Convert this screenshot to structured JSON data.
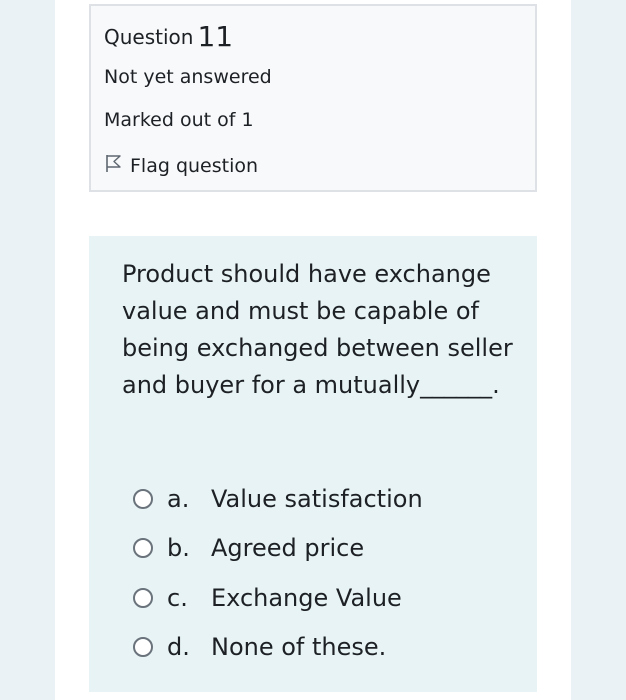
{
  "question_info": {
    "label": "Question",
    "number": "11",
    "state": "Not yet answered",
    "grade": "Marked out of 1",
    "flag_label": "Flag question"
  },
  "question": {
    "text": "Product should have exchange value and must be capable of being exchanged between seller and buyer for a mutually______.",
    "options": [
      {
        "letter": "a.",
        "text": "Value satisfaction"
      },
      {
        "letter": "b.",
        "text": "Agreed price"
      },
      {
        "letter": "c.",
        "text": "Exchange Value"
      },
      {
        "letter": "d.",
        "text": "None of these."
      }
    ]
  }
}
